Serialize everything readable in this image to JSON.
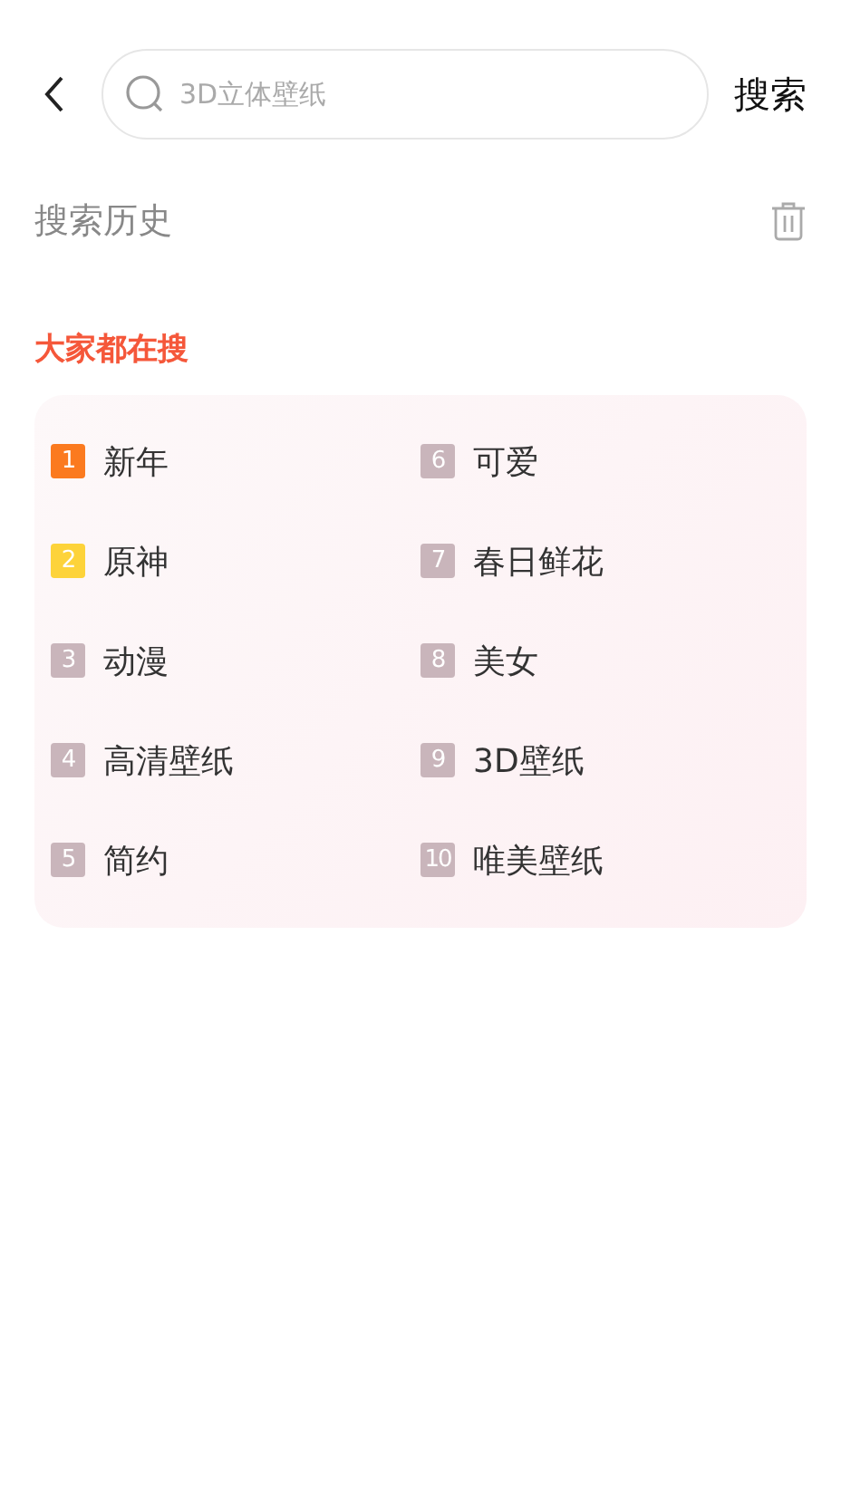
{
  "search": {
    "placeholder": "3D立体壁纸",
    "button": "搜索"
  },
  "history": {
    "title": "搜索历史"
  },
  "hot": {
    "title": "大家都在搜",
    "items": [
      {
        "rank": "1",
        "label": "新年",
        "color": "#fb7a1f"
      },
      {
        "rank": "2",
        "label": "原神",
        "color": "#fdd33a"
      },
      {
        "rank": "3",
        "label": "动漫",
        "color": "#c9b5bb"
      },
      {
        "rank": "4",
        "label": "高清壁纸",
        "color": "#c9b5bb"
      },
      {
        "rank": "5",
        "label": "简约",
        "color": "#c9b5bb"
      },
      {
        "rank": "6",
        "label": "可爱",
        "color": "#c9b5bb"
      },
      {
        "rank": "7",
        "label": "春日鲜花",
        "color": "#c9b5bb"
      },
      {
        "rank": "8",
        "label": "美女",
        "color": "#c9b5bb"
      },
      {
        "rank": "9",
        "label": "3D壁纸",
        "color": "#c9b5bb"
      },
      {
        "rank": "10",
        "label": "唯美壁纸",
        "color": "#c9b5bb"
      }
    ]
  }
}
